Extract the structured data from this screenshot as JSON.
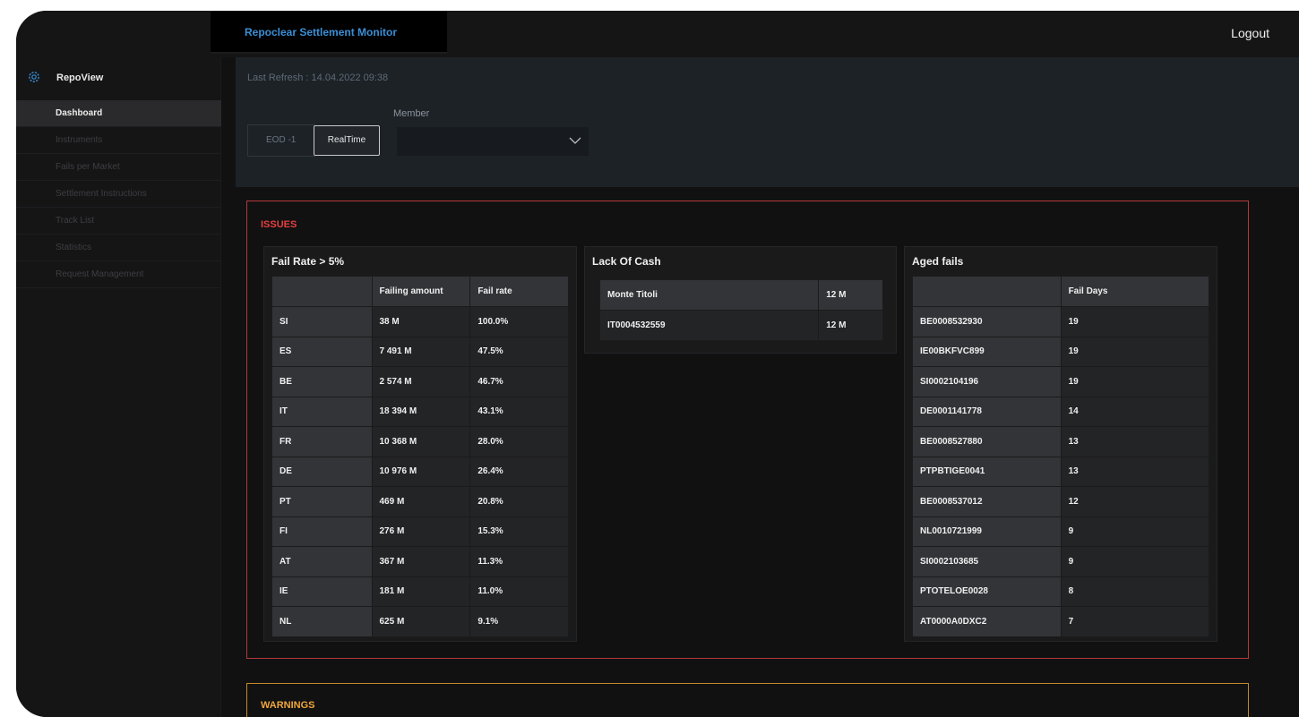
{
  "header": {
    "app_title": "Repoclear Settlement Monitor",
    "logout_label": "Logout"
  },
  "sidebar": {
    "title": "RepoView",
    "items": [
      {
        "label": "Dashboard",
        "active": true
      },
      {
        "label": "Instruments"
      },
      {
        "label": "Fails per Market"
      },
      {
        "label": "Settlement Instructions"
      },
      {
        "label": "Track List"
      },
      {
        "label": "Statistics"
      },
      {
        "label": "Request Management"
      }
    ]
  },
  "controls": {
    "last_refresh": "Last Refresh : 14.04.2022 09:38",
    "eod_label": "EOD -1",
    "realtime_label": "RealTime",
    "member_label": "Member",
    "member_value": ""
  },
  "issues": {
    "title": "ISSUES",
    "fail_rate": {
      "title": "Fail Rate > 5%",
      "columns": [
        "",
        "Failing amount",
        "Fail rate"
      ],
      "rows": [
        [
          "SI",
          "38 M",
          "100.0%"
        ],
        [
          "ES",
          "7 491 M",
          "47.5%"
        ],
        [
          "BE",
          "2 574 M",
          "46.7%"
        ],
        [
          "IT",
          "18 394 M",
          "43.1%"
        ],
        [
          "FR",
          "10 368 M",
          "28.0%"
        ],
        [
          "DE",
          "10 976 M",
          "26.4%"
        ],
        [
          "PT",
          "469 M",
          "20.8%"
        ],
        [
          "FI",
          "276 M",
          "15.3%"
        ],
        [
          "AT",
          "367 M",
          "11.3%"
        ],
        [
          "IE",
          "181 M",
          "11.0%"
        ],
        [
          "NL",
          "625 M",
          "9.1%"
        ]
      ]
    },
    "lack_of_cash": {
      "title": "Lack Of Cash",
      "columns": [
        "Monte Titoli",
        "12 M"
      ],
      "rows": [
        [
          "IT0004532559",
          "12 M"
        ]
      ]
    },
    "aged_fails": {
      "title": "Aged fails",
      "columns": [
        "",
        "Fail Days"
      ],
      "rows": [
        [
          "BE0008532930",
          "19"
        ],
        [
          "IE00BKFVC899",
          "19"
        ],
        [
          "SI0002104196",
          "19"
        ],
        [
          "DE0001141778",
          "14"
        ],
        [
          "BE0008527880",
          "13"
        ],
        [
          "PTPBTIGE0041",
          "13"
        ],
        [
          "BE0008537012",
          "12"
        ],
        [
          "NL0010721999",
          "9"
        ],
        [
          "SI0002103685",
          "9"
        ],
        [
          "PTOTELOE0028",
          "8"
        ],
        [
          "AT0000A0DXC2",
          "7"
        ]
      ]
    }
  },
  "warnings": {
    "title": "WARNINGS"
  },
  "colors": {
    "brand_blue": "#3a8fd6",
    "issues_red": "#e6403f",
    "warnings_orange": "#f0a73a"
  }
}
